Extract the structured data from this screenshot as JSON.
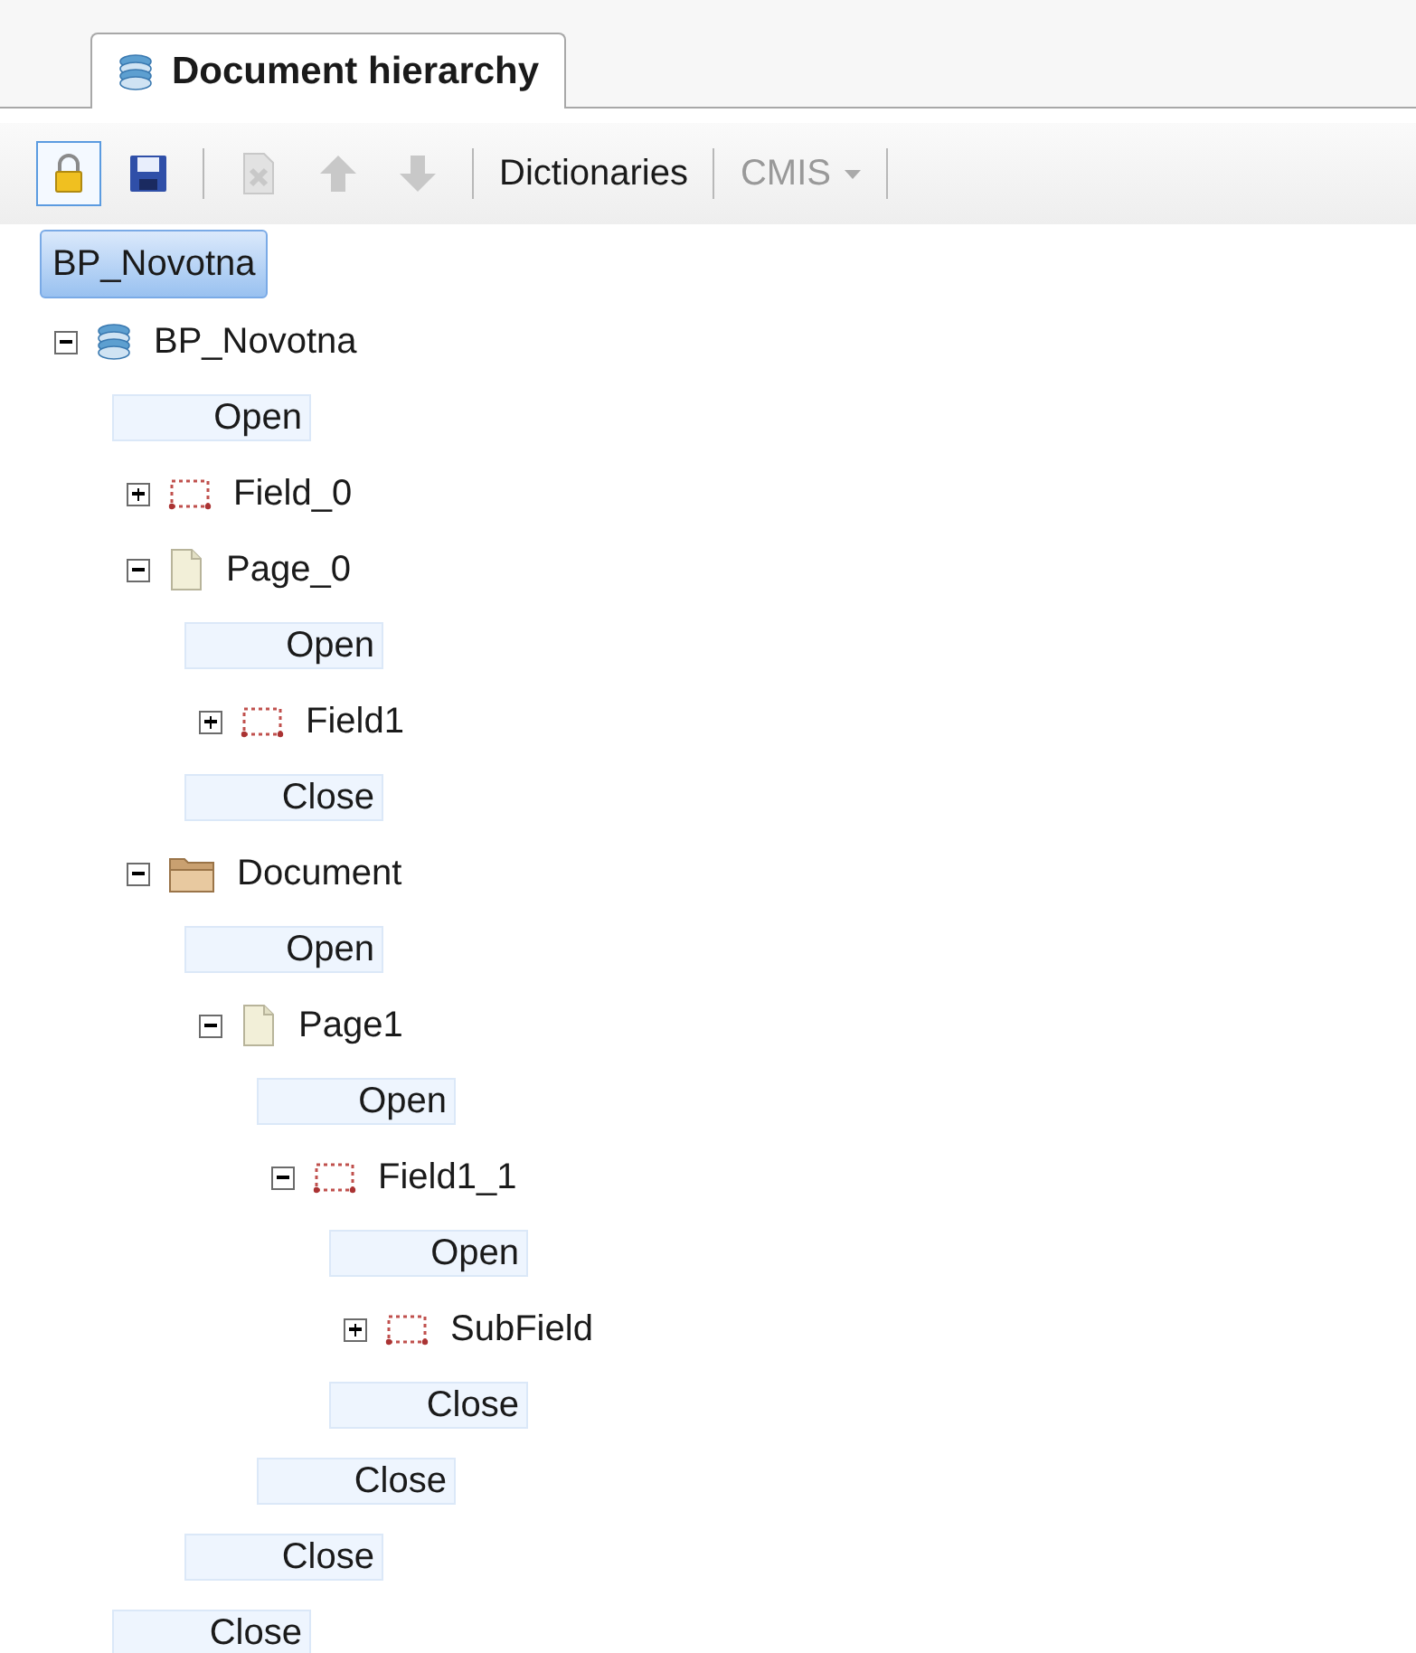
{
  "tabs": [
    {
      "label": "Document hierarchy",
      "selected": true
    }
  ],
  "toolbar": [
    {
      "kind": "lock",
      "pressed": true,
      "disabled": false
    },
    {
      "kind": "save",
      "pressed": false,
      "disabled": false
    },
    {
      "kind": "separator"
    },
    {
      "kind": "delete",
      "pressed": false,
      "disabled": true
    },
    {
      "kind": "up",
      "pressed": false,
      "disabled": true
    },
    {
      "kind": "down",
      "pressed": false,
      "disabled": true
    },
    {
      "kind": "separator"
    },
    {
      "kind": "text",
      "label": "Dictionaries",
      "disabled": false
    },
    {
      "kind": "separator"
    },
    {
      "kind": "dropdown",
      "label": "CMIS",
      "disabled": true
    },
    {
      "kind": "separator"
    }
  ],
  "breadcrumb": [
    {
      "label": "BP_Novotna",
      "selected": true
    }
  ],
  "tree": [
    {
      "kind": "database",
      "label": "BP_Novotna",
      "expanded": true,
      "open_label": "Open",
      "close_label": "Close",
      "children": [
        {
          "kind": "field",
          "label": "Field_0",
          "expanded": false
        },
        {
          "kind": "page",
          "label": "Page_0",
          "expanded": true,
          "open_label": "Open",
          "close_label": "Close",
          "children": [
            {
              "kind": "field",
              "label": "Field1",
              "expanded": false
            }
          ]
        },
        {
          "kind": "folder",
          "label": "Document",
          "expanded": true,
          "open_label": "Open",
          "close_label": "Close",
          "children": [
            {
              "kind": "page",
              "label": "Page1",
              "expanded": true,
              "open_label": "Open",
              "close_label": "Close",
              "children": [
                {
                  "kind": "field",
                  "label": "Field1_1",
                  "expanded": true,
                  "open_label": "Open",
                  "close_label": "Close",
                  "children": [
                    {
                      "kind": "field",
                      "label": "SubField",
                      "expanded": false
                    }
                  ]
                }
              ]
            }
          ]
        }
      ]
    }
  ]
}
